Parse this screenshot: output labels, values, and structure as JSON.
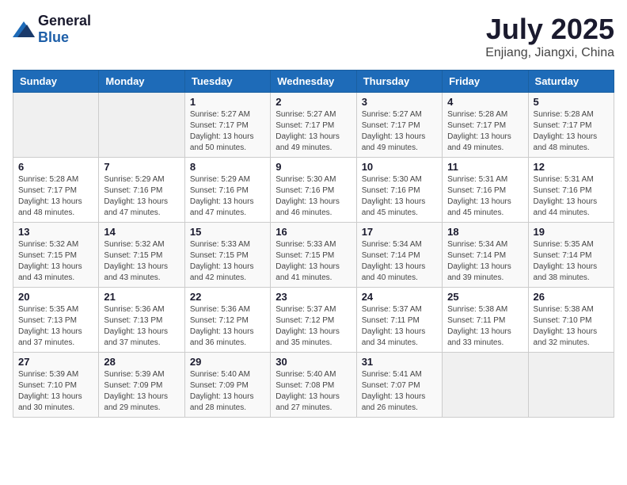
{
  "logo": {
    "general": "General",
    "blue": "Blue"
  },
  "header": {
    "month": "July 2025",
    "location": "Enjiang, Jiangxi, China"
  },
  "days_of_week": [
    "Sunday",
    "Monday",
    "Tuesday",
    "Wednesday",
    "Thursday",
    "Friday",
    "Saturday"
  ],
  "weeks": [
    [
      {
        "day": "",
        "sunrise": "",
        "sunset": "",
        "daylight": ""
      },
      {
        "day": "",
        "sunrise": "",
        "sunset": "",
        "daylight": ""
      },
      {
        "day": "1",
        "sunrise": "Sunrise: 5:27 AM",
        "sunset": "Sunset: 7:17 PM",
        "daylight": "Daylight: 13 hours and 50 minutes."
      },
      {
        "day": "2",
        "sunrise": "Sunrise: 5:27 AM",
        "sunset": "Sunset: 7:17 PM",
        "daylight": "Daylight: 13 hours and 49 minutes."
      },
      {
        "day": "3",
        "sunrise": "Sunrise: 5:27 AM",
        "sunset": "Sunset: 7:17 PM",
        "daylight": "Daylight: 13 hours and 49 minutes."
      },
      {
        "day": "4",
        "sunrise": "Sunrise: 5:28 AM",
        "sunset": "Sunset: 7:17 PM",
        "daylight": "Daylight: 13 hours and 49 minutes."
      },
      {
        "day": "5",
        "sunrise": "Sunrise: 5:28 AM",
        "sunset": "Sunset: 7:17 PM",
        "daylight": "Daylight: 13 hours and 48 minutes."
      }
    ],
    [
      {
        "day": "6",
        "sunrise": "Sunrise: 5:28 AM",
        "sunset": "Sunset: 7:17 PM",
        "daylight": "Daylight: 13 hours and 48 minutes."
      },
      {
        "day": "7",
        "sunrise": "Sunrise: 5:29 AM",
        "sunset": "Sunset: 7:16 PM",
        "daylight": "Daylight: 13 hours and 47 minutes."
      },
      {
        "day": "8",
        "sunrise": "Sunrise: 5:29 AM",
        "sunset": "Sunset: 7:16 PM",
        "daylight": "Daylight: 13 hours and 47 minutes."
      },
      {
        "day": "9",
        "sunrise": "Sunrise: 5:30 AM",
        "sunset": "Sunset: 7:16 PM",
        "daylight": "Daylight: 13 hours and 46 minutes."
      },
      {
        "day": "10",
        "sunrise": "Sunrise: 5:30 AM",
        "sunset": "Sunset: 7:16 PM",
        "daylight": "Daylight: 13 hours and 45 minutes."
      },
      {
        "day": "11",
        "sunrise": "Sunrise: 5:31 AM",
        "sunset": "Sunset: 7:16 PM",
        "daylight": "Daylight: 13 hours and 45 minutes."
      },
      {
        "day": "12",
        "sunrise": "Sunrise: 5:31 AM",
        "sunset": "Sunset: 7:16 PM",
        "daylight": "Daylight: 13 hours and 44 minutes."
      }
    ],
    [
      {
        "day": "13",
        "sunrise": "Sunrise: 5:32 AM",
        "sunset": "Sunset: 7:15 PM",
        "daylight": "Daylight: 13 hours and 43 minutes."
      },
      {
        "day": "14",
        "sunrise": "Sunrise: 5:32 AM",
        "sunset": "Sunset: 7:15 PM",
        "daylight": "Daylight: 13 hours and 43 minutes."
      },
      {
        "day": "15",
        "sunrise": "Sunrise: 5:33 AM",
        "sunset": "Sunset: 7:15 PM",
        "daylight": "Daylight: 13 hours and 42 minutes."
      },
      {
        "day": "16",
        "sunrise": "Sunrise: 5:33 AM",
        "sunset": "Sunset: 7:15 PM",
        "daylight": "Daylight: 13 hours and 41 minutes."
      },
      {
        "day": "17",
        "sunrise": "Sunrise: 5:34 AM",
        "sunset": "Sunset: 7:14 PM",
        "daylight": "Daylight: 13 hours and 40 minutes."
      },
      {
        "day": "18",
        "sunrise": "Sunrise: 5:34 AM",
        "sunset": "Sunset: 7:14 PM",
        "daylight": "Daylight: 13 hours and 39 minutes."
      },
      {
        "day": "19",
        "sunrise": "Sunrise: 5:35 AM",
        "sunset": "Sunset: 7:14 PM",
        "daylight": "Daylight: 13 hours and 38 minutes."
      }
    ],
    [
      {
        "day": "20",
        "sunrise": "Sunrise: 5:35 AM",
        "sunset": "Sunset: 7:13 PM",
        "daylight": "Daylight: 13 hours and 37 minutes."
      },
      {
        "day": "21",
        "sunrise": "Sunrise: 5:36 AM",
        "sunset": "Sunset: 7:13 PM",
        "daylight": "Daylight: 13 hours and 37 minutes."
      },
      {
        "day": "22",
        "sunrise": "Sunrise: 5:36 AM",
        "sunset": "Sunset: 7:12 PM",
        "daylight": "Daylight: 13 hours and 36 minutes."
      },
      {
        "day": "23",
        "sunrise": "Sunrise: 5:37 AM",
        "sunset": "Sunset: 7:12 PM",
        "daylight": "Daylight: 13 hours and 35 minutes."
      },
      {
        "day": "24",
        "sunrise": "Sunrise: 5:37 AM",
        "sunset": "Sunset: 7:11 PM",
        "daylight": "Daylight: 13 hours and 34 minutes."
      },
      {
        "day": "25",
        "sunrise": "Sunrise: 5:38 AM",
        "sunset": "Sunset: 7:11 PM",
        "daylight": "Daylight: 13 hours and 33 minutes."
      },
      {
        "day": "26",
        "sunrise": "Sunrise: 5:38 AM",
        "sunset": "Sunset: 7:10 PM",
        "daylight": "Daylight: 13 hours and 32 minutes."
      }
    ],
    [
      {
        "day": "27",
        "sunrise": "Sunrise: 5:39 AM",
        "sunset": "Sunset: 7:10 PM",
        "daylight": "Daylight: 13 hours and 30 minutes."
      },
      {
        "day": "28",
        "sunrise": "Sunrise: 5:39 AM",
        "sunset": "Sunset: 7:09 PM",
        "daylight": "Daylight: 13 hours and 29 minutes."
      },
      {
        "day": "29",
        "sunrise": "Sunrise: 5:40 AM",
        "sunset": "Sunset: 7:09 PM",
        "daylight": "Daylight: 13 hours and 28 minutes."
      },
      {
        "day": "30",
        "sunrise": "Sunrise: 5:40 AM",
        "sunset": "Sunset: 7:08 PM",
        "daylight": "Daylight: 13 hours and 27 minutes."
      },
      {
        "day": "31",
        "sunrise": "Sunrise: 5:41 AM",
        "sunset": "Sunset: 7:07 PM",
        "daylight": "Daylight: 13 hours and 26 minutes."
      },
      {
        "day": "",
        "sunrise": "",
        "sunset": "",
        "daylight": ""
      },
      {
        "day": "",
        "sunrise": "",
        "sunset": "",
        "daylight": ""
      }
    ]
  ]
}
